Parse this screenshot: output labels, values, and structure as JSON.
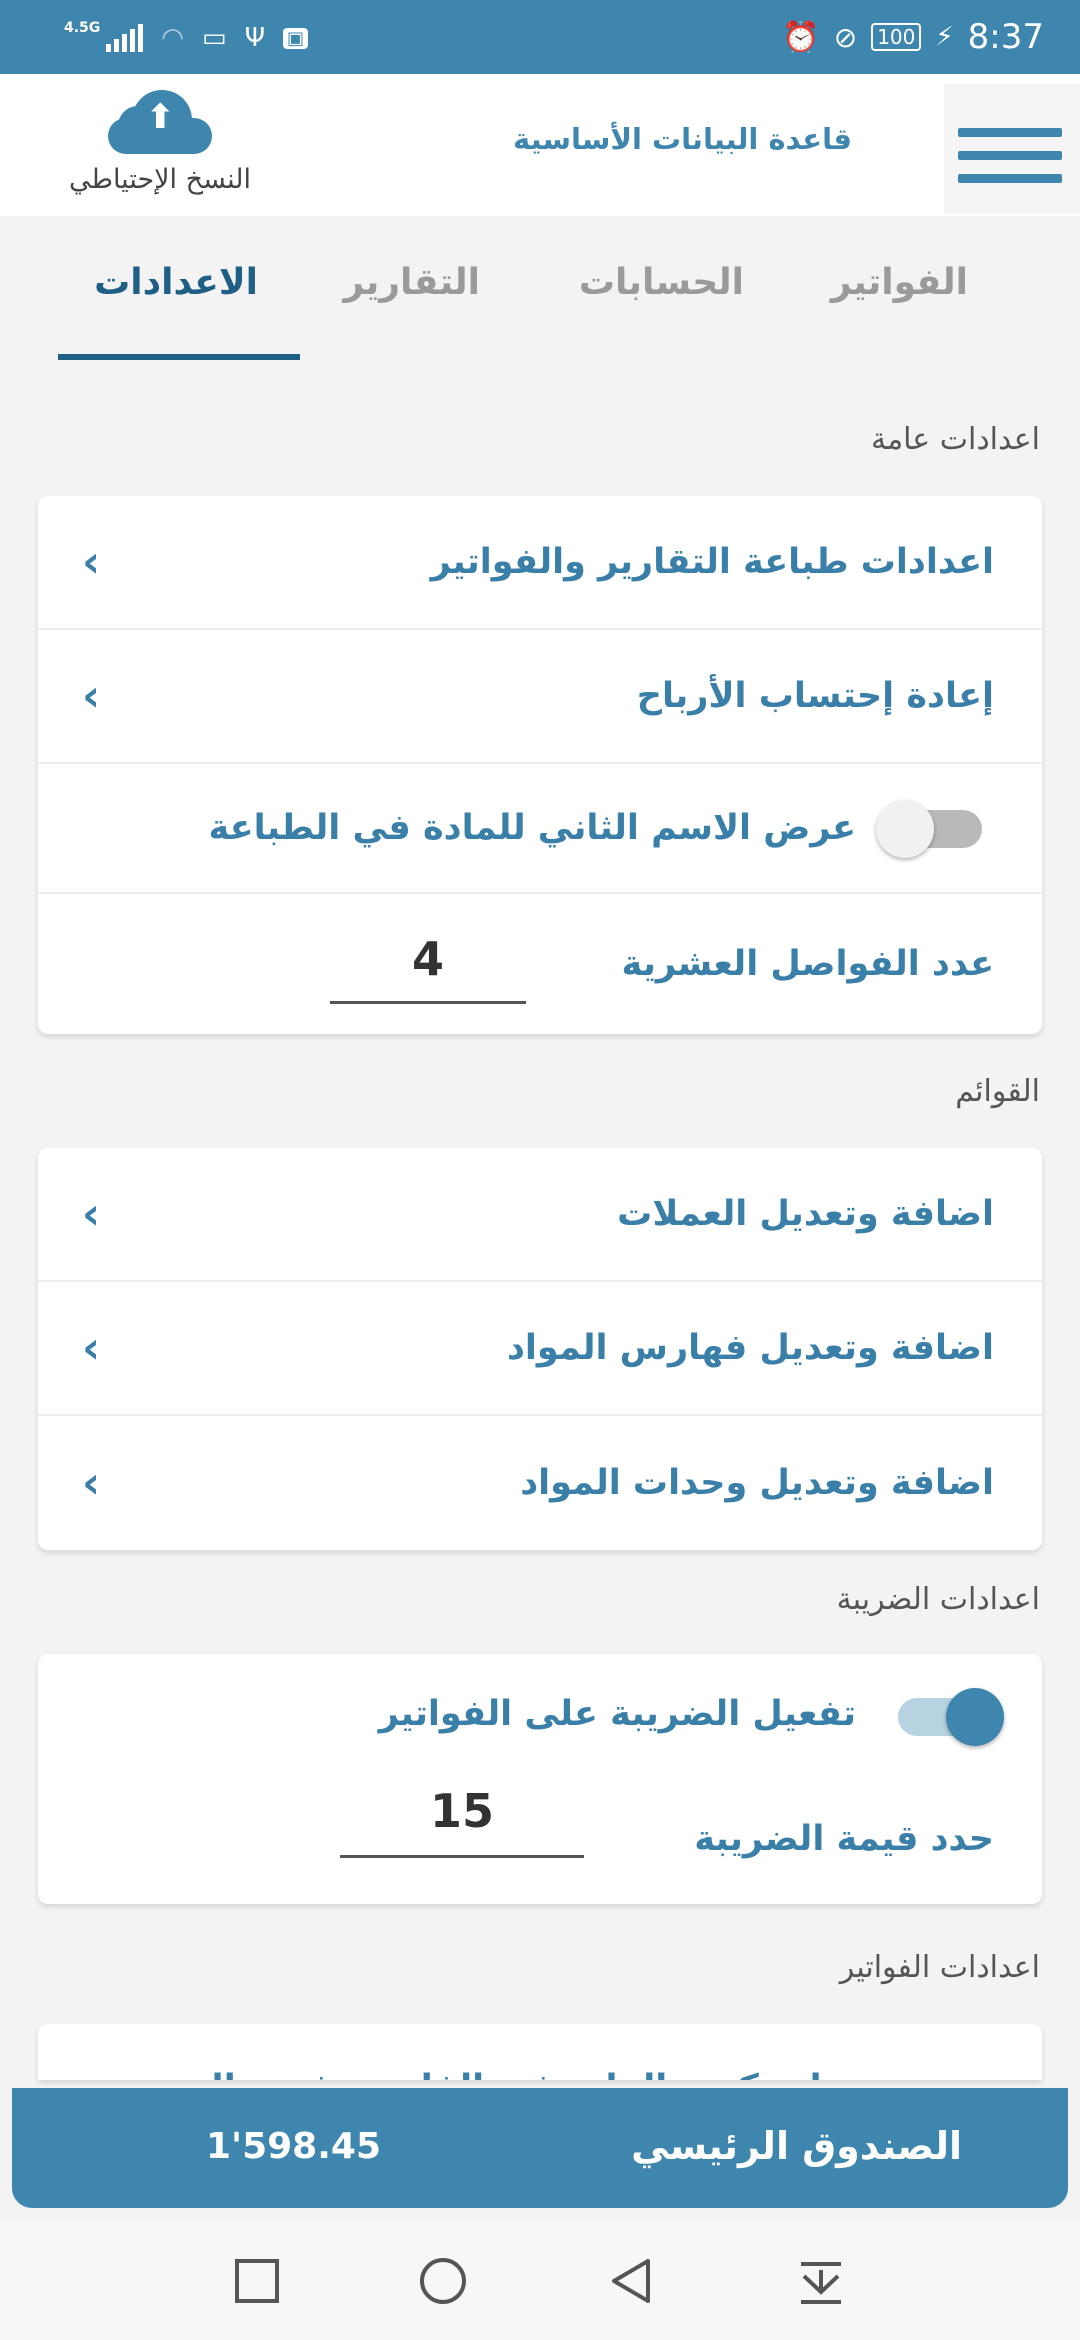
{
  "status_bar": {
    "network": "4.5G",
    "battery": "100",
    "time": "8:37"
  },
  "header": {
    "backup_label": "النسخ الإحتياطي",
    "db_title": "قاعدة البيانات الأساسية"
  },
  "tabs": [
    {
      "label": "الفواتير"
    },
    {
      "label": "الحسابات"
    },
    {
      "label": "التقارير"
    },
    {
      "label": "الاعدادات",
      "active": true
    }
  ],
  "general": {
    "title": "اعدادات عامة",
    "print_settings": "اعدادات طباعة التقارير والفواتير",
    "recalc_profits": "إعادة إحتساب الأرباح",
    "second_name_toggle": "عرض الاسم الثاني للمادة في الطباعة",
    "second_name_on": false,
    "decimals_label": "عدد الفواصل العشرية",
    "decimals_value": "4"
  },
  "lists": {
    "title": "القوائم",
    "currencies": "اضافة وتعديل العملات",
    "catalogs": "اضافة وتعديل فهارس المواد",
    "units": "اضافة وتعديل وحدات المواد"
  },
  "tax": {
    "title": "اعدادات الضريبة",
    "enable_label": "تفعيل الضريبة على الفواتير",
    "enabled": true,
    "value_label": "حدد قيمة الضريبة",
    "value": "15"
  },
  "invoices": {
    "title": "اعدادات الفواتير",
    "first_item": "زيادة كمية المادة في الفاتورة في حال"
  },
  "cash_box": {
    "label": "الصندوق الرئيسي",
    "value": "1'598.45"
  },
  "colors": {
    "primary": "#3e86ad",
    "active_tab": "#1f5f85",
    "text_accent": "#3a7fa8"
  }
}
